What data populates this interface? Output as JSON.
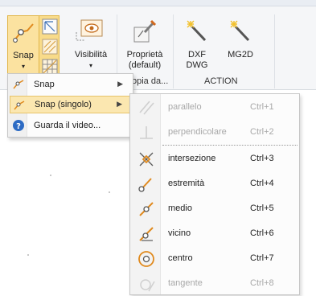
{
  "ribbon": {
    "snap_label": "Snap",
    "visibilita_label": "Visibilità",
    "proprieta_line1": "Proprietà",
    "proprieta_line2": "(default)",
    "proprieta_group_partial": "opia da...",
    "dxf_line1": "DXF",
    "dxf_line2": "DWG",
    "mg2d_label": "MG2D",
    "action_group_label": "ACTION"
  },
  "snap_menu": {
    "items": [
      {
        "label": "Snap",
        "icon": "snap-icon",
        "has_submenu": true
      },
      {
        "label": "Snap (singolo)",
        "icon": "snap-single-icon",
        "has_submenu": true,
        "highlighted": true
      },
      {
        "label": "Guarda il video...",
        "icon": "help-icon",
        "has_submenu": false
      }
    ]
  },
  "snap_submenu": {
    "items": [
      {
        "label": "parallelo",
        "shortcut": "Ctrl+1",
        "enabled": false,
        "icon": "parallel-icon"
      },
      {
        "label": "perpendicolare",
        "shortcut": "Ctrl+2",
        "enabled": false,
        "icon": "perpendicular-icon"
      },
      {
        "label": "intersezione",
        "shortcut": "Ctrl+3",
        "enabled": true,
        "icon": "intersection-icon"
      },
      {
        "label": "estremità",
        "shortcut": "Ctrl+4",
        "enabled": true,
        "icon": "endpoint-icon"
      },
      {
        "label": "medio",
        "shortcut": "Ctrl+5",
        "enabled": true,
        "icon": "midpoint-icon"
      },
      {
        "label": "vicino",
        "shortcut": "Ctrl+6",
        "enabled": true,
        "icon": "nearest-icon"
      },
      {
        "label": "centro",
        "shortcut": "Ctrl+7",
        "enabled": true,
        "icon": "center-icon"
      },
      {
        "label": "tangente",
        "shortcut": "Ctrl+8",
        "enabled": false,
        "icon": "tangent-icon"
      }
    ]
  },
  "colors": {
    "highlight": "#fbe7b0",
    "highlight_border": "#e7c36a",
    "snap_orange": "#e08a1e",
    "disabled_text": "#a8a8a8"
  }
}
